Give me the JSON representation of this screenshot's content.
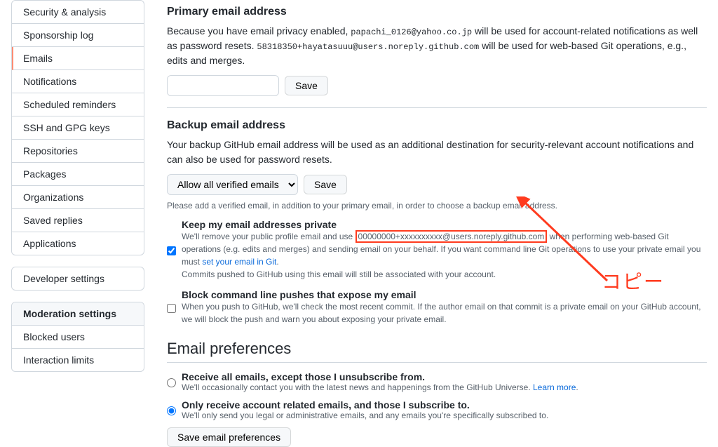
{
  "sidebar": {
    "group1": [
      "Security & analysis",
      "Sponsorship log",
      "Emails",
      "Notifications",
      "Scheduled reminders",
      "SSH and GPG keys",
      "Repositories",
      "Packages",
      "Organizations",
      "Saved replies",
      "Applications"
    ],
    "devsettings": "Developer settings",
    "moderation_header": "Moderation settings",
    "moderation_items": [
      "Blocked users",
      "Interaction limits"
    ]
  },
  "primary": {
    "title": "Primary email address",
    "desc_pre": "Because you have email privacy enabled, ",
    "email1": "papachi_0126@yahoo.co.jp",
    "desc_mid": " will be used for account-related notifications as well as password resets. ",
    "email2": "58318350+hayatasuuu@users.noreply.github.com",
    "desc_post": " will be used for web-based Git operations, e.g., edits and merges.",
    "save": "Save"
  },
  "backup": {
    "title": "Backup email address",
    "desc": "Your backup GitHub email address will be used as an additional destination for security-relevant account notifications and can also be used for password resets.",
    "select": "Allow all verified emails",
    "save": "Save",
    "note": "Please add a verified email, in addition to your primary email, in order to choose a backup email address."
  },
  "keepPrivate": {
    "title": "Keep my email addresses private",
    "d1": "We'll remove your public profile email and use ",
    "masked": "00000000+xxxxxxxxxx@users.noreply.github.com",
    "d2": " when performing web-based Git operations (e.g. edits and merges) and sending email on your behalf. If you want command line Git operations to use your private email you must ",
    "link": "set your email in Git",
    "d3": ".",
    "d4": "Commits pushed to GitHub using this email will still be associated with your account."
  },
  "block": {
    "title": "Block command line pushes that expose my email",
    "desc": "When you push to GitHub, we'll check the most recent commit. If the author email on that commit is a private email on your GitHub account, we will block the push and warn you about exposing your private email."
  },
  "prefs": {
    "title": "Email preferences",
    "opt1_title": "Receive all emails, except those I unsubscribe from.",
    "opt1_desc": "We'll occasionally contact you with the latest news and happenings from the GitHub Universe. ",
    "opt1_link": "Learn more",
    "opt2_title": "Only receive account related emails, and those I subscribe to.",
    "opt2_desc": "We'll only send you legal or administrative emails, and any emails you're specifically subscribed to.",
    "save": "Save email preferences"
  },
  "annotation": {
    "copy": "コピー"
  }
}
